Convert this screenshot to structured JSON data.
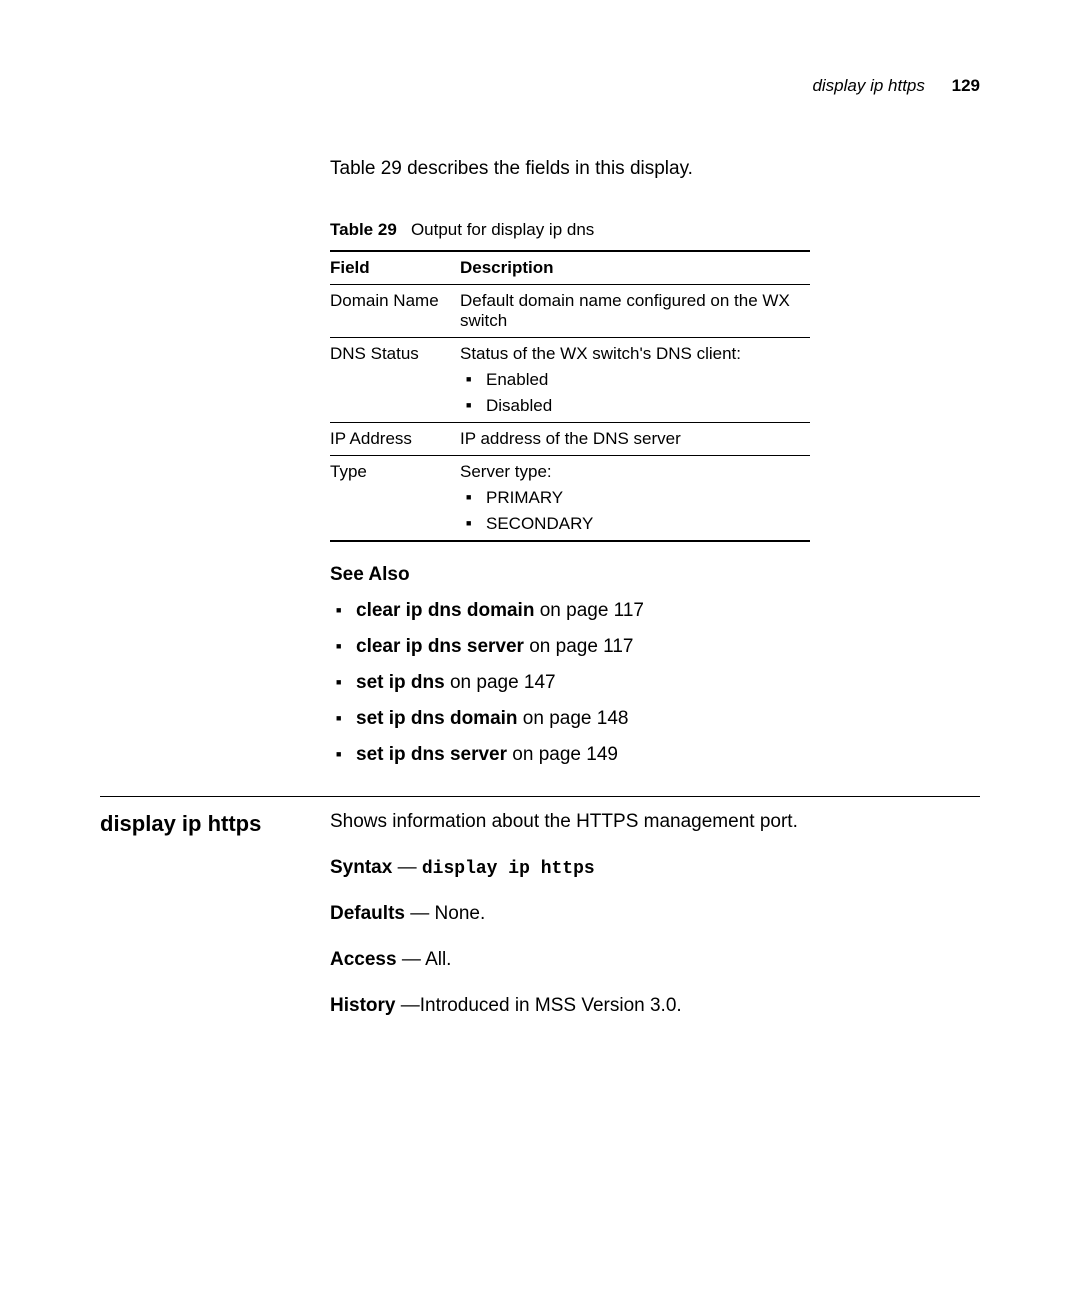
{
  "header": {
    "title": "display ip https",
    "page_number": "129"
  },
  "intro": "Table 29 describes the fields in this display.",
  "table_caption": {
    "label": "Table 29",
    "text": "Output for display ip dns"
  },
  "table_headers": {
    "field": "Field",
    "description": "Description"
  },
  "rows": [
    {
      "field": "Domain Name",
      "desc": "Default domain name configured on the WX switch",
      "items": []
    },
    {
      "field": "DNS Status",
      "desc": "Status of the WX switch's DNS client:",
      "items": [
        "Enabled",
        "Disabled"
      ]
    },
    {
      "field": "IP Address",
      "desc": "IP address of the DNS server",
      "items": []
    },
    {
      "field": "Type",
      "desc": "Server type:",
      "items": [
        "PRIMARY",
        "SECONDARY"
      ]
    }
  ],
  "see_also_heading": "See Also",
  "see_also": [
    {
      "cmd": "clear ip dns domain",
      "rest": " on page 117"
    },
    {
      "cmd": "clear ip dns server",
      "rest": " on page 117"
    },
    {
      "cmd": "set ip dns",
      "rest": " on page 147"
    },
    {
      "cmd": "set ip dns domain",
      "rest": " on page 148"
    },
    {
      "cmd": "set ip dns server",
      "rest": " on page 149"
    }
  ],
  "command": {
    "name": "display ip https",
    "description": "Shows information about the HTTPS management port.",
    "syntax_label": "Syntax",
    "syntax_sep": " — ",
    "syntax_cmd": "display ip https",
    "defaults_label": "Defaults",
    "defaults_value": " — None.",
    "access_label": "Access",
    "access_value": " — All.",
    "history_label": "History",
    "history_value": " —Introduced in MSS Version 3.0."
  }
}
